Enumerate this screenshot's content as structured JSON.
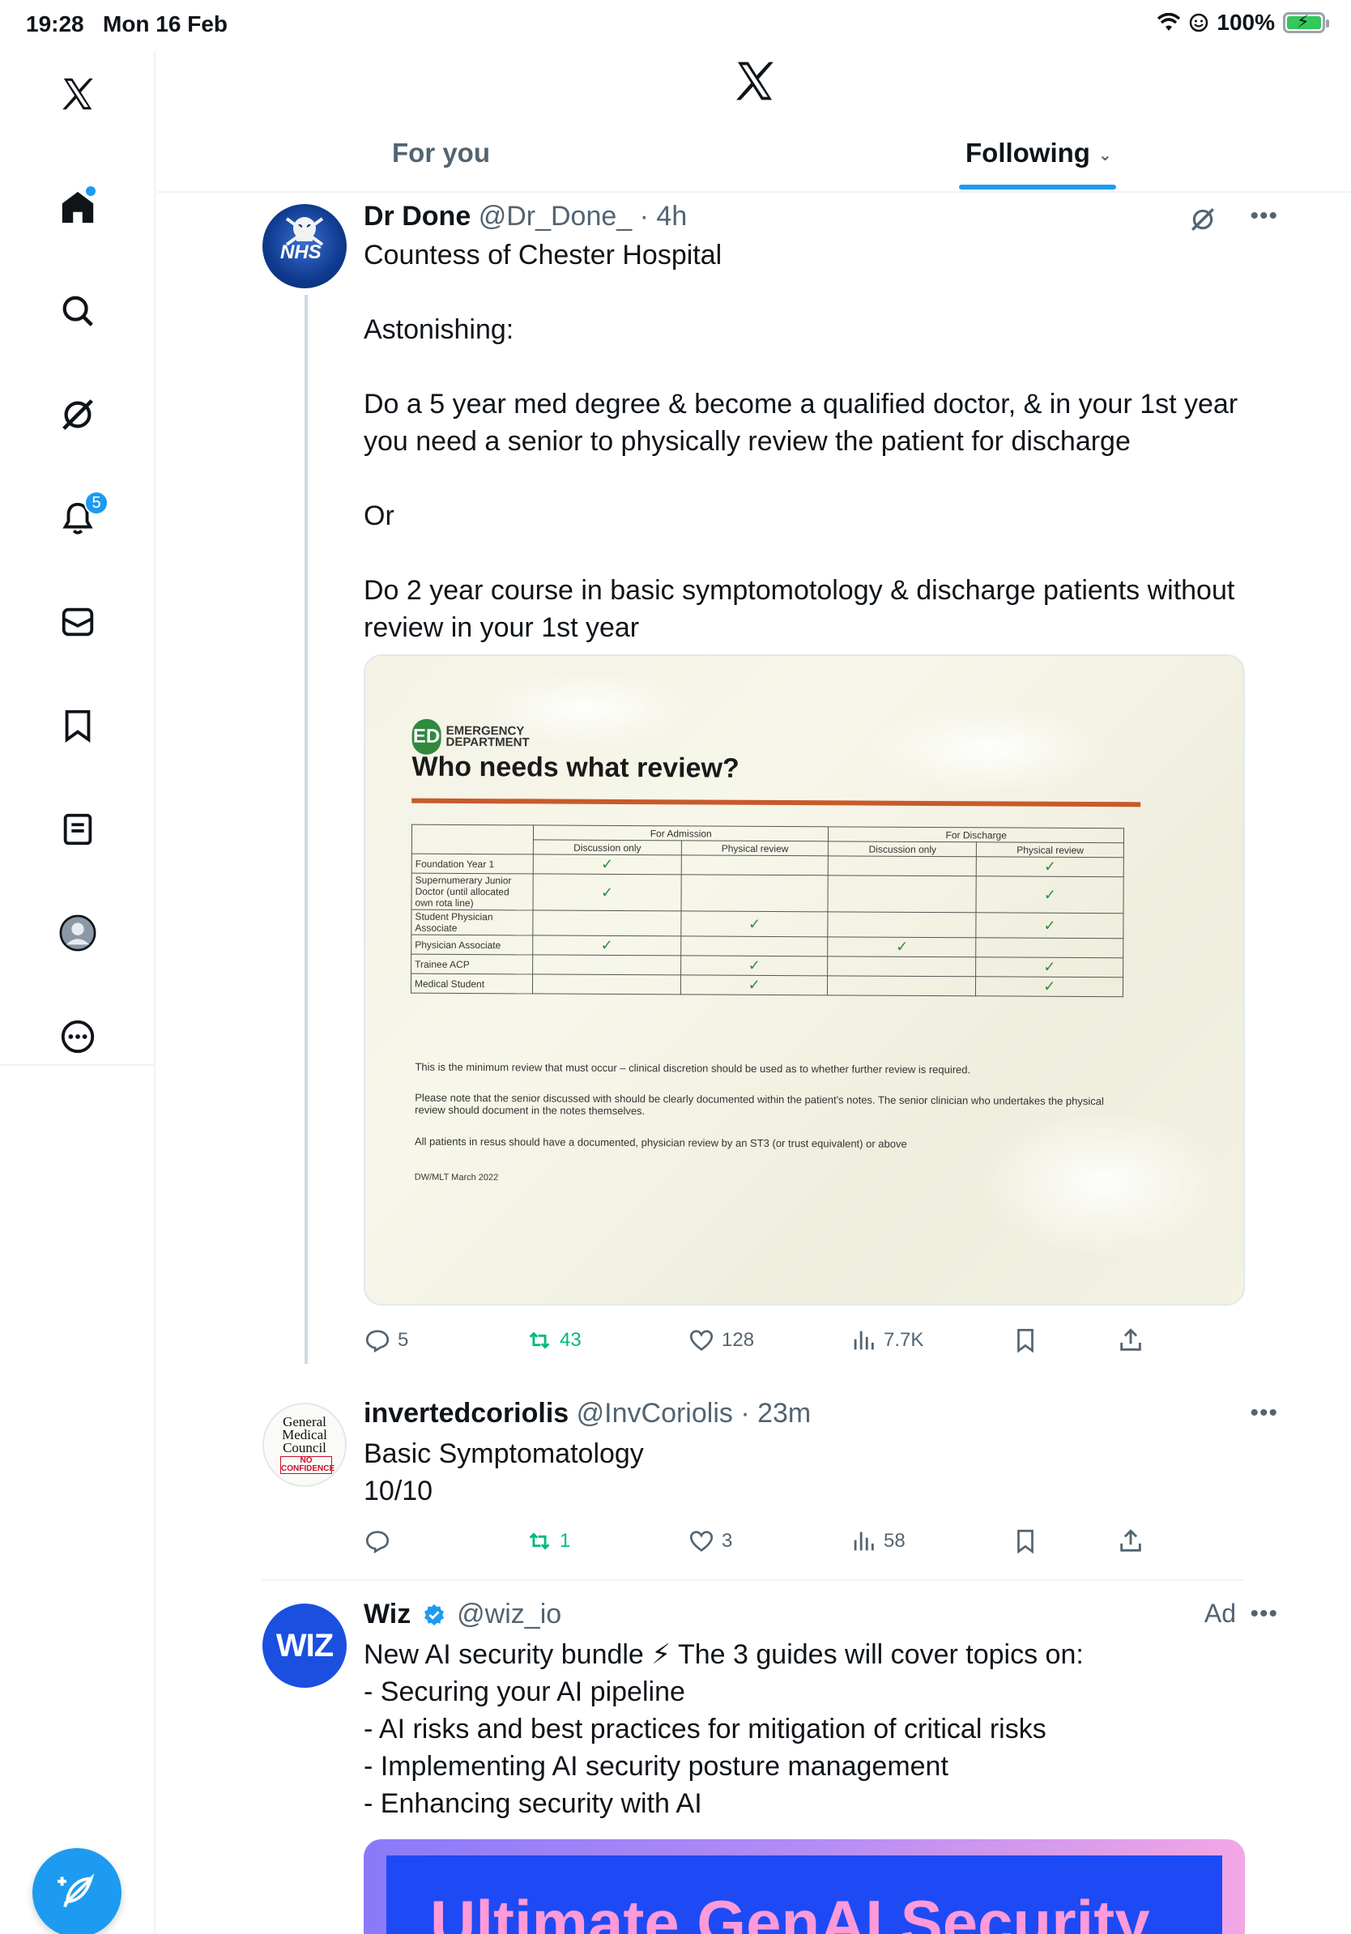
{
  "status_bar": {
    "time": "19:28",
    "date": "Mon 16 Feb",
    "battery": "100%"
  },
  "sidebar": {
    "items": [
      {
        "name": "x-logo"
      },
      {
        "name": "home",
        "has_dot": true
      },
      {
        "name": "search"
      },
      {
        "name": "grok"
      },
      {
        "name": "notifications",
        "badge": "5"
      },
      {
        "name": "messages"
      },
      {
        "name": "bookmarks"
      },
      {
        "name": "lists"
      },
      {
        "name": "profile"
      },
      {
        "name": "more"
      }
    ]
  },
  "header": {
    "tabs": [
      {
        "label": "For you",
        "active": false
      },
      {
        "label": "Following",
        "active": true
      }
    ]
  },
  "tweets": [
    {
      "name": "Dr Done",
      "handle": "@Dr_Done_",
      "time": "4h",
      "avatar_text": "NHS",
      "body": [
        "Countess of Chester Hospital",
        "",
        "Astonishing:",
        "",
        "Do a 5 year med degree & become a qualified doctor, & in your 1st year you need a senior to physically review the patient for discharge",
        "",
        "Or",
        "",
        "Do 2 year course in basic symptomotology & discharge patients without review in your 1st year"
      ],
      "media": {
        "logo_text": "EMERGENCY DEPARTMENT",
        "logo_badge": "ED",
        "title": "Who needs what review?",
        "group_headers": [
          "For Admission",
          "For Discharge"
        ],
        "sub_headers": [
          "Discussion only",
          "Physical review",
          "Discussion only",
          "Physical review"
        ],
        "rows": [
          {
            "label": "Foundation Year 1",
            "cells": [
              "✓",
              "",
              "",
              "✓"
            ]
          },
          {
            "label": "Supernumerary Junior Doctor (until allocated own rota line)",
            "cells": [
              "✓",
              "",
              "",
              "✓"
            ]
          },
          {
            "label": "Student Physician Associate",
            "cells": [
              "",
              "✓",
              "",
              "✓"
            ]
          },
          {
            "label": "Physician Associate",
            "cells": [
              "✓",
              "",
              "✓",
              ""
            ]
          },
          {
            "label": "Trainee ACP",
            "cells": [
              "",
              "✓",
              "",
              "✓"
            ]
          },
          {
            "label": "Medical Student",
            "cells": [
              "",
              "✓",
              "",
              "✓"
            ]
          }
        ],
        "note_1": "This is the minimum review that must occur – clinical discretion should be used as to whether further review is required.",
        "note_2": "Please note that the senior discussed with should be clearly documented within the patient's notes. The senior clinician who undertakes the physical review should document in the notes themselves.",
        "note_3": "All patients in resus should have a documented, physician review by an ST3 (or trust equivalent) or above",
        "note_4": "DW/MLT March 2022"
      },
      "stats": {
        "replies": "5",
        "reposts": "43",
        "likes": "128",
        "views": "7.7K"
      }
    },
    {
      "name": "invertedcoriolis",
      "handle": "@InvCoriolis",
      "time": "23m",
      "avatar_lines": [
        "General",
        "Medical",
        "Council",
        "NO",
        "CONFIDENCE"
      ],
      "body": [
        "Basic Symptomatology",
        "10/10"
      ],
      "stats": {
        "replies": "",
        "reposts": "1",
        "likes": "3",
        "views": "58"
      }
    },
    {
      "name": "Wiz",
      "handle": "@wiz_io",
      "ad_label": "Ad",
      "avatar_text": "WIZ",
      "body": [
        "New AI security bundle ⚡ The 3 guides will cover topics on:",
        "- Securing your AI pipeline",
        "- AI risks and best practices for mitigation of critical risks",
        "- Implementing AI security posture management",
        "- Enhancing security with AI"
      ],
      "media_text": "Ultimate GenAI Security"
    }
  ],
  "colors": {
    "accent": "#1d9bf0",
    "text": "#0f1419",
    "secondary": "#536471",
    "repost_green": "#00ba7c"
  }
}
